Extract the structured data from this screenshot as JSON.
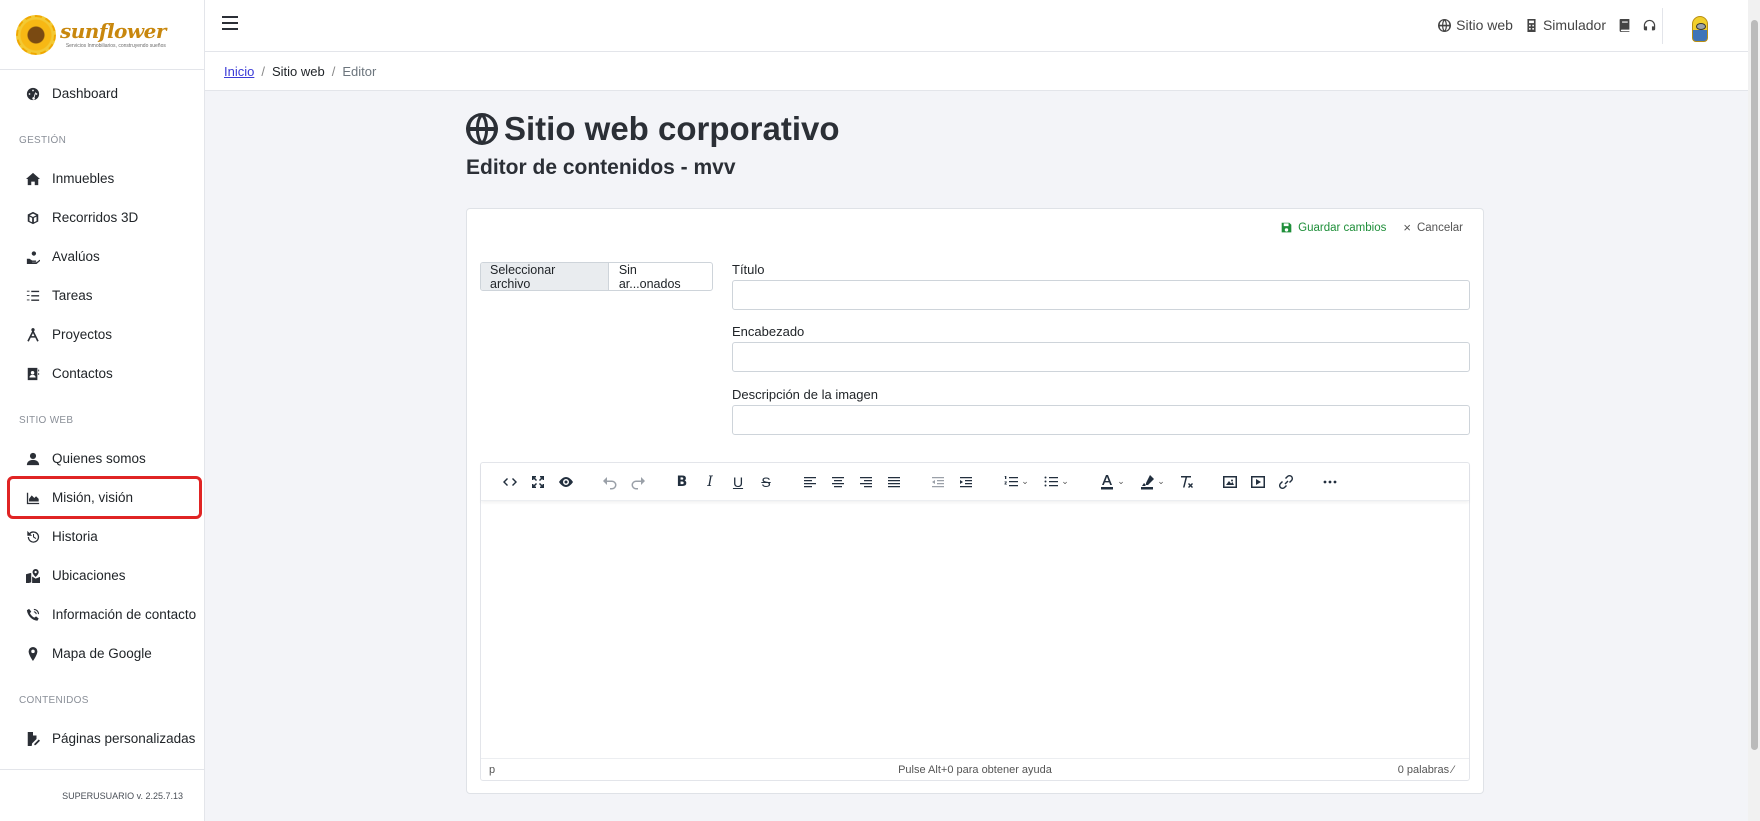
{
  "sidebar": {
    "logo_text": "sunflower",
    "logo_tagline": "Servicios Inmobiliarios, construyendo sueños",
    "items": [
      {
        "label": "Dashboard",
        "icon": "dashboard-icon"
      },
      {
        "section": "GESTIÓN"
      },
      {
        "label": "Inmuebles",
        "icon": "home-icon"
      },
      {
        "label": "Recorridos 3D",
        "icon": "cube-icon"
      },
      {
        "label": "Avalúos",
        "icon": "hand-coin-icon"
      },
      {
        "label": "Tareas",
        "icon": "task-list-icon"
      },
      {
        "label": "Proyectos",
        "icon": "compass-icon"
      },
      {
        "label": "Contactos",
        "icon": "address-book-icon"
      },
      {
        "section": "SITIO WEB"
      },
      {
        "label": "Quienes somos",
        "icon": "user-icon"
      },
      {
        "label": "Misión, visión",
        "icon": "chart-area-icon",
        "active": true
      },
      {
        "label": "Historia",
        "icon": "history-icon"
      },
      {
        "label": "Ubicaciones",
        "icon": "map-location-icon"
      },
      {
        "label": "Información de contacto",
        "icon": "phone-volume-icon"
      },
      {
        "label": "Mapa de Google",
        "icon": "map-pin-icon"
      },
      {
        "section": "CONTENIDOS"
      },
      {
        "label": "Páginas personalizadas",
        "icon": "file-edit-icon"
      }
    ],
    "footer": "SUPERUSUARIO v. 2.25.7.13"
  },
  "topbar": {
    "links": [
      {
        "label": "Sitio web",
        "icon": "globe-icon"
      },
      {
        "label": "Simulador",
        "icon": "calculator-icon"
      }
    ]
  },
  "breadcrumb": {
    "home": "Inicio",
    "section": "Sitio web",
    "current": "Editor"
  },
  "page": {
    "title": "Sitio web corporativo",
    "subtitle": "Editor de contenidos - mvv"
  },
  "form": {
    "save_label": "Guardar cambios",
    "cancel_label": "Cancelar",
    "file_button": "Seleccionar archivo",
    "file_status": "Sin ar...onados",
    "fields": {
      "title_label": "Título",
      "header_label": "Encabezado",
      "image_desc_label": "Descripción de la imagen"
    }
  },
  "editor": {
    "status_path": "p",
    "help_text": "Pulse Alt+0 para obtener ayuda",
    "word_count": "0 palabras"
  },
  "colors": {
    "accent_green": "#1f8f3a",
    "active_outline": "#e02424",
    "link_blue": "#3b3bd7"
  }
}
